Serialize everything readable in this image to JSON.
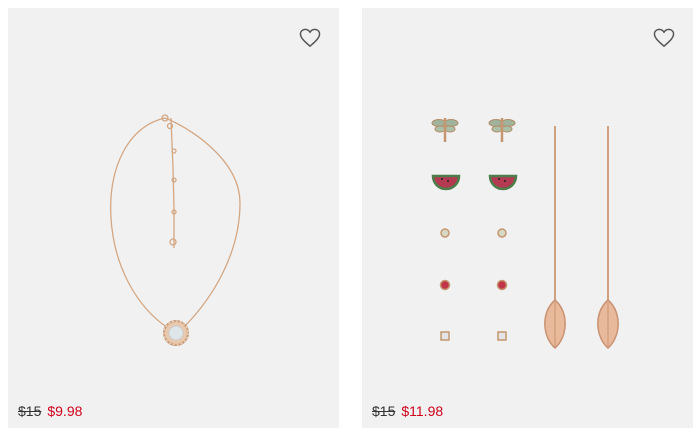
{
  "products": [
    {
      "image_icon": "necklace-pendant-image",
      "wishlist_icon": "heart-icon",
      "original_price": "$15",
      "sale_price": "$9.98"
    },
    {
      "image_icon": "earring-set-image",
      "wishlist_icon": "heart-icon",
      "original_price": "$15",
      "sale_price": "$11.98"
    }
  ],
  "colors": {
    "card_bg": "#f1f1f1",
    "sale_red": "#d0021b",
    "gold": "#d9ab86"
  }
}
